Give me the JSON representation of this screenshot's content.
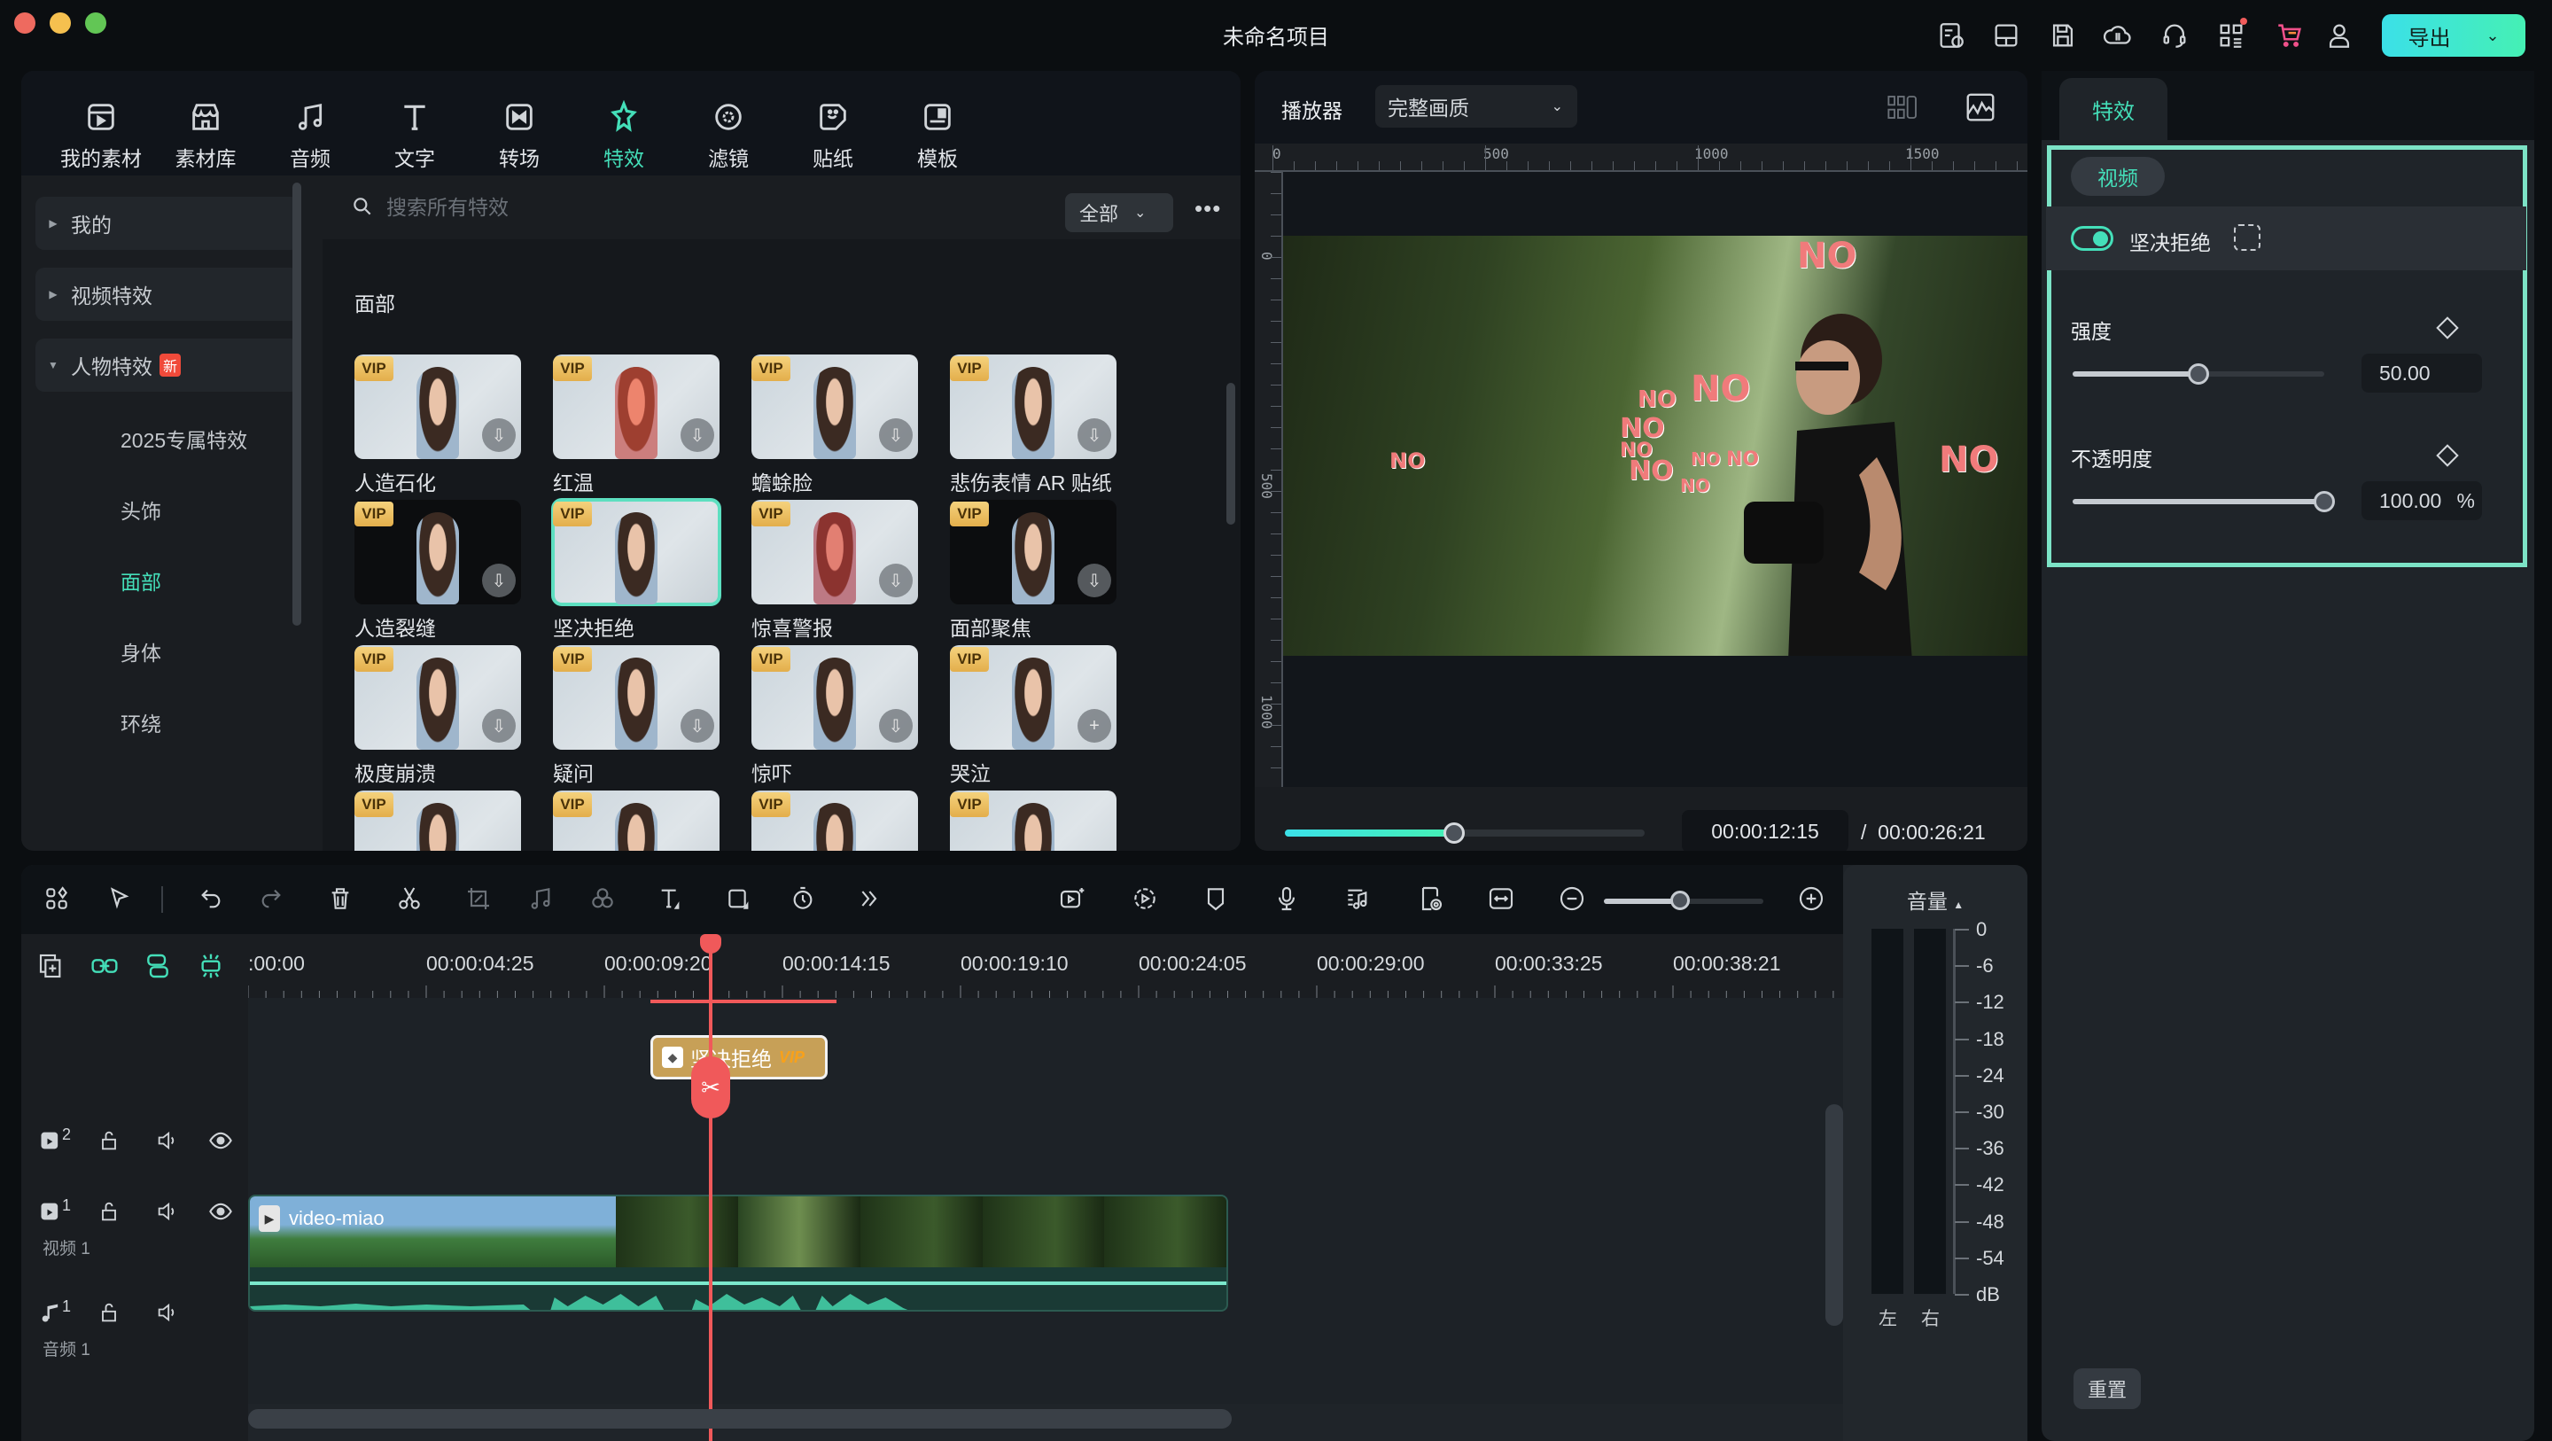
{
  "window": {
    "title": "未命名项目",
    "traffic_lights": {
      "close": "#ee6a5f",
      "minimize": "#f5c04f",
      "maximize": "#62c655"
    }
  },
  "header": {
    "icons": [
      "project-history-icon",
      "layout-icon",
      "save-icon",
      "cloud-sync-icon",
      "headset-support-icon",
      "apps-grid-icon",
      "cart-icon",
      "user-account-icon"
    ],
    "export_label": "导出",
    "accent": "#44dfb9"
  },
  "media": {
    "tabs": [
      {
        "label": "我的素材",
        "icon": "my-media-icon"
      },
      {
        "label": "素材库",
        "icon": "stock-library-icon"
      },
      {
        "label": "音频",
        "icon": "music-note-icon"
      },
      {
        "label": "文字",
        "icon": "text-icon"
      },
      {
        "label": "转场",
        "icon": "transition-icon"
      },
      {
        "label": "特效",
        "icon": "effects-star-icon",
        "active": true
      },
      {
        "label": "滤镜",
        "icon": "filter-icon"
      },
      {
        "label": "贴纸",
        "icon": "sticker-icon"
      },
      {
        "label": "模板",
        "icon": "template-icon"
      }
    ],
    "sidebar": {
      "groups": [
        {
          "label": "我的",
          "expanded": false
        },
        {
          "label": "视频特效",
          "expanded": false
        },
        {
          "label": "人物特效",
          "expanded": true,
          "badge": "新"
        }
      ],
      "subitems": [
        {
          "label": "2025专属特效"
        },
        {
          "label": "头饰"
        },
        {
          "label": "面部",
          "active": true
        },
        {
          "label": "身体"
        },
        {
          "label": "环绕"
        }
      ]
    },
    "search": {
      "placeholder": "搜索所有特效",
      "value": ""
    },
    "filter": "全部",
    "more": "•••",
    "category_title": "面部",
    "effects": [
      {
        "label": "人造石化",
        "badge": "VIP",
        "action": "download"
      },
      {
        "label": "红温",
        "badge": "VIP",
        "action": "download"
      },
      {
        "label": "蟾蜍脸",
        "badge": "VIP",
        "action": "download"
      },
      {
        "label": "悲伤表情 AR 贴纸",
        "badge": "VIP",
        "action": "download"
      },
      {
        "label": "人造裂缝",
        "badge": "VIP",
        "action": "download"
      },
      {
        "label": "坚决拒绝",
        "badge": "VIP",
        "action": "none",
        "selected": true
      },
      {
        "label": "惊喜警报",
        "badge": "VIP",
        "action": "download"
      },
      {
        "label": "面部聚焦",
        "badge": "VIP",
        "action": "download"
      },
      {
        "label": "极度崩溃",
        "badge": "VIP",
        "action": "download"
      },
      {
        "label": "疑问",
        "badge": "VIP",
        "action": "download"
      },
      {
        "label": "惊吓",
        "badge": "VIP",
        "action": "download"
      },
      {
        "label": "哭泣",
        "badge": "VIP",
        "action": "add"
      },
      {
        "label": "",
        "badge": "VIP",
        "action": "download"
      },
      {
        "label": "",
        "badge": "VIP",
        "action": "download"
      },
      {
        "label": "",
        "badge": "VIP",
        "action": "download"
      },
      {
        "label": "",
        "badge": "VIP",
        "action": "download"
      }
    ]
  },
  "player": {
    "label": "播放器",
    "quality": "完整画质",
    "ruler_h": [
      "0",
      "500",
      "1000",
      "1500"
    ],
    "ruler_v": [
      "0",
      "500",
      "1000"
    ],
    "overlay_text": "NO",
    "progress_fraction": 0.47,
    "current_time": "00:00:12:15",
    "separator": "/",
    "total_time": "00:00:26:21",
    "controls": [
      "prev-frame-icon",
      "next-frame-icon",
      "play-icon",
      "stop-icon",
      "mark-in-icon",
      "mark-out-icon",
      "insert-icon",
      "display-settings-icon",
      "snapshot-icon",
      "mute-icon",
      "fullscreen-icon"
    ]
  },
  "properties": {
    "tab": "特效",
    "section": "视频",
    "effect_name": "坚决拒绝",
    "effect_enabled": true,
    "params": [
      {
        "label": "强度",
        "value": "50.00",
        "unit": "",
        "fraction": 0.5
      },
      {
        "label": "不透明度",
        "value": "100.00",
        "unit": "%",
        "fraction": 1.0
      }
    ],
    "reset_label": "重置"
  },
  "timeline": {
    "toolbar_left": [
      "layout-icon",
      "select-tool-icon",
      "undo-icon",
      "redo-icon",
      "delete-icon",
      "cut-icon",
      "crop-icon",
      "audio-edit-icon",
      "color-icon",
      "text-tool-icon",
      "shape-icon",
      "speed-icon",
      "more-tools-icon"
    ],
    "toolbar_right": [
      "ai-video-icon",
      "auto-play-icon",
      "marker-icon",
      "record-voice-icon",
      "audio-mix-icon",
      "render-preview-icon",
      "fit-icon",
      "zoom-out-icon",
      "zoom-in-icon"
    ],
    "zoom_fraction": 0.48,
    "header_tools": [
      "add-track-icon",
      "link-icon",
      "group-icon",
      "snap-icon"
    ],
    "timecodes": [
      ":00:00",
      "00:00:04:25",
      "00:00:09:20",
      "00:00:14:15",
      "00:00:19:10",
      "00:00:24:05",
      "00:00:29:00",
      "00:00:33:25",
      "00:00:38:21"
    ],
    "tracks": [
      {
        "index": "2",
        "type": "video",
        "name": ""
      },
      {
        "index": "1",
        "type": "video",
        "name": "视频 1"
      },
      {
        "index": "1",
        "type": "audio",
        "name": "音频 1"
      }
    ],
    "effect_clip": {
      "label": "坚决拒绝",
      "badge": "VIP"
    },
    "video_clip": {
      "label": "video-miao"
    }
  },
  "volume_meter": {
    "title": "音量",
    "scale": [
      "0",
      "-6",
      "-12",
      "-18",
      "-24",
      "-30",
      "-36",
      "-42",
      "-48",
      "-54",
      "dB"
    ],
    "channels": [
      "左",
      "右"
    ]
  }
}
